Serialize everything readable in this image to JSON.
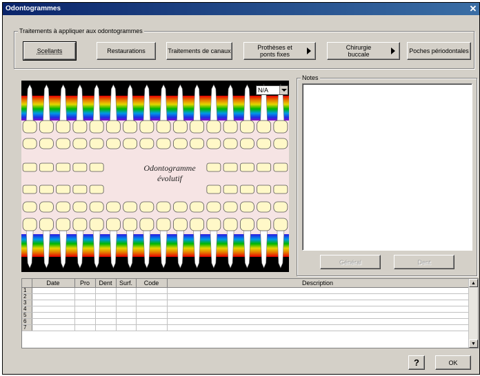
{
  "window": {
    "title": "Odontogrammes",
    "close_glyph": "✕"
  },
  "treatments": {
    "group_label": "Traitements à appliquer aux odontogrammes",
    "buttons": [
      {
        "label": "Scellants"
      },
      {
        "label": "Restaurations"
      },
      {
        "label": "Traitements de canaux"
      },
      {
        "label_line1": "Prothèses et",
        "label_line2": "ponts fixes"
      },
      {
        "label_line1": "Chirurgie",
        "label_line2": "buccale"
      },
      {
        "label": "Poches périodontales"
      }
    ]
  },
  "odontogram": {
    "combo_value": "N/A",
    "title_line1": "Odontogramme",
    "title_line2": "évolutif"
  },
  "notes": {
    "group_label": "Notes",
    "general_button": "Général",
    "dent_button": "Dent"
  },
  "grid": {
    "columns": [
      "Date",
      "Pro",
      "Dent",
      "Surf.",
      "Code",
      "Description"
    ],
    "row_numbers": [
      "1",
      "2",
      "3",
      "4",
      "5",
      "6",
      "7"
    ]
  },
  "footer": {
    "help_label": "?",
    "ok_label": "OK"
  }
}
